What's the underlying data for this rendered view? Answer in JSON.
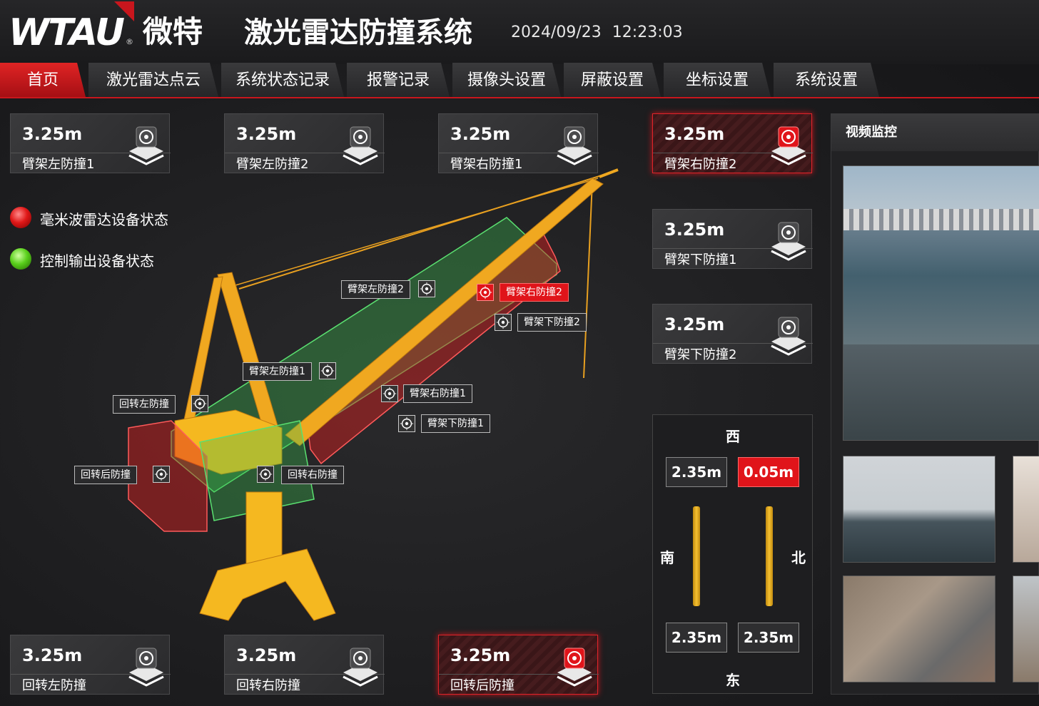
{
  "header": {
    "logo_text": "WTAU",
    "logo_cn": "微特",
    "app_title": "激光雷达防撞系统",
    "datetime": "2024/09/23  12:23:03",
    "accent_color": "#c8161d"
  },
  "tabs": [
    {
      "label": "首页",
      "active": true
    },
    {
      "label": "激光雷达点云"
    },
    {
      "label": "系统状态记录"
    },
    {
      "label": "报警记录"
    },
    {
      "label": "摄像头设置"
    },
    {
      "label": "屏蔽设置"
    },
    {
      "label": "坐标设置"
    },
    {
      "label": "系统设置"
    }
  ],
  "sensor_cards": [
    {
      "value": "3.25m",
      "label": "臂架左防撞1",
      "alert": false
    },
    {
      "value": "3.25m",
      "label": "臂架左防撞2",
      "alert": false
    },
    {
      "value": "3.25m",
      "label": "臂架右防撞1",
      "alert": false
    },
    {
      "value": "3.25m",
      "label": "臂架右防撞2",
      "alert": true
    },
    {
      "value": "3.25m",
      "label": "臂架下防撞1",
      "alert": false
    },
    {
      "value": "3.25m",
      "label": "臂架下防撞2",
      "alert": false
    },
    {
      "value": "3.25m",
      "label": "回转左防撞",
      "alert": false
    },
    {
      "value": "3.25m",
      "label": "回转右防撞",
      "alert": false
    },
    {
      "value": "3.25m",
      "label": "回转后防撞",
      "alert": true
    }
  ],
  "device_status": [
    {
      "label": "毫米波雷达设备状态",
      "state": "red"
    },
    {
      "label": "控制输出设备状态",
      "state": "green"
    }
  ],
  "crane_callouts": [
    {
      "label": "臂架左防撞2",
      "alert": false
    },
    {
      "label": "臂架右防撞2",
      "alert": true
    },
    {
      "label": "臂架下防撞2",
      "alert": false
    },
    {
      "label": "臂架左防撞1",
      "alert": false
    },
    {
      "label": "臂架右防撞1",
      "alert": false
    },
    {
      "label": "臂架下防撞1",
      "alert": false
    },
    {
      "label": "回转左防撞",
      "alert": false
    },
    {
      "label": "回转后防撞",
      "alert": false
    },
    {
      "label": "回转右防撞",
      "alert": false
    }
  ],
  "compass": {
    "west": "西",
    "east": "东",
    "south": "南",
    "north": "北",
    "top_left": {
      "value": "2.35m",
      "alert": false
    },
    "top_right": {
      "value": "0.05m",
      "alert": true
    },
    "bottom_left": {
      "value": "2.35m",
      "alert": false
    },
    "bottom_right": {
      "value": "2.35m",
      "alert": false
    }
  },
  "video": {
    "title": "视频监控"
  }
}
